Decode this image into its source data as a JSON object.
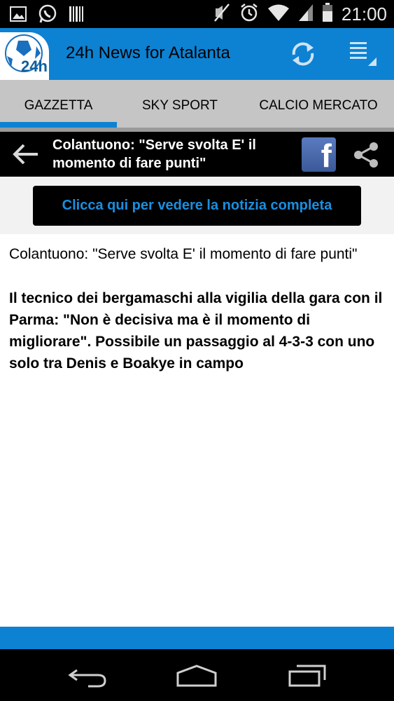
{
  "status_bar": {
    "time": "21:00",
    "left_icons": [
      "gallery-icon",
      "whatsapp-icon",
      "barcode-icon"
    ],
    "right_icons": [
      "mute-icon",
      "alarm-icon",
      "wifi-icon",
      "signal-icon",
      "battery-icon"
    ]
  },
  "app_bar": {
    "logo_text": "24h",
    "title": "24h News for Atalanta",
    "refresh_icon": "refresh-icon",
    "menu_icon": "menu-icon"
  },
  "tabs": [
    {
      "label": "GAZZETTA",
      "selected": true
    },
    {
      "label": "SKY SPORT",
      "selected": false
    },
    {
      "label": "CALCIO MERCATO",
      "selected": false
    }
  ],
  "article_bar": {
    "title": "Colantuono: \"Serve svolta E' il momento di fare punti\"",
    "back_icon": "back-arrow-icon",
    "facebook_icon": "facebook-icon",
    "share_icon": "share-icon"
  },
  "content": {
    "cta_label": "Clicca qui per vedere la notizia completa",
    "heading": "Colantuono: \"Serve svolta E' il momento di fare punti\"",
    "summary": "Il tecnico dei bergamaschi alla vigilia della gara con il Parma: \"Non è decisiva ma è il momento di migliorare\". Possibile un passaggio al 4-3-3 con uno solo tra Denis e Boakye in campo"
  },
  "colors": {
    "accent": "#0d82d2",
    "cta_text": "#1a8fe0",
    "tab_background": "#c5c5c5"
  }
}
